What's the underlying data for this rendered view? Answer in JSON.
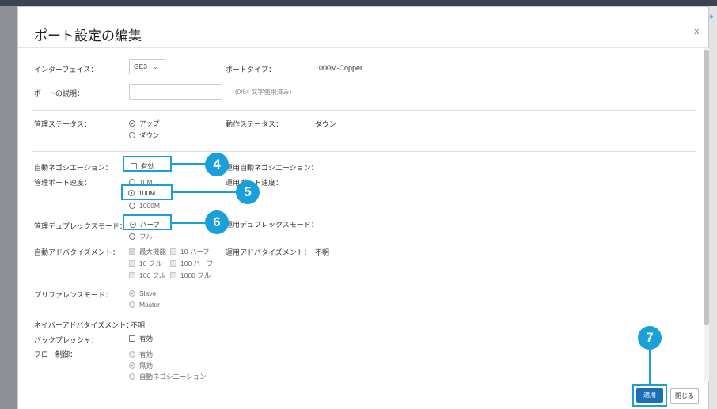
{
  "dialog": {
    "title": "ポート設定の編集",
    "close": "x"
  },
  "fields": {
    "interface_label": "インターフェイス：",
    "interface_value": "GE3",
    "port_type_label": "ポートタイプ：",
    "port_type_value": "1000M-Copper",
    "port_desc_label": "ポートの説明：",
    "port_desc_value": "",
    "port_desc_hint": "(0/64 文字使用済み)",
    "admin_status_label": "管理ステータス：",
    "admin_status_options": [
      "アップ",
      "ダウン"
    ],
    "admin_status_selected": "アップ",
    "oper_status_label": "動作ステータス：",
    "oper_status_value": "ダウン",
    "auto_neg_label": "自動ネゴシエーション：",
    "auto_neg_option": "有効",
    "oper_auto_neg_label": "運用自動ネゴシエーション：",
    "admin_speed_label": "管理ポート速度：",
    "speed_options": [
      "10M",
      "100M",
      "1000M"
    ],
    "speed_selected": "100M",
    "oper_speed_label": "運用ポート速度：",
    "admin_duplex_label": "管理デュプレックスモード：",
    "duplex_options": [
      "ハーフ",
      "フル"
    ],
    "duplex_selected": "ハーフ",
    "oper_duplex_label": "運用デュプレックスモード：",
    "auto_adv_label": "自動アドバタイズメント：",
    "auto_adv_options": [
      "最大機能",
      "10 ハーフ",
      "10 フル",
      "100 ハーフ",
      "100 フル",
      "1000 フル"
    ],
    "oper_auto_adv_label": "運用アドバタイズメント：",
    "oper_auto_adv_value": "不明",
    "pref_mode_label": "プリファレンスモード：",
    "pref_mode_options": [
      "Slave",
      "Master"
    ],
    "neighbor_adv_label": "ネイバーアドバタイズメント：",
    "neighbor_adv_value": "不明",
    "back_pressure_label": "バックプレッシャ：",
    "back_pressure_option": "有効",
    "flow_control_label": "フロー制御：",
    "flow_control_options": [
      "有効",
      "無効",
      "自動ネゴシエーション"
    ]
  },
  "footer": {
    "apply": "適用",
    "close": "閉じる"
  },
  "callouts": [
    "4",
    "5",
    "6",
    "7"
  ],
  "colors": {
    "accent": "#1aa0d8",
    "apply_button": "#1a6fb5"
  }
}
